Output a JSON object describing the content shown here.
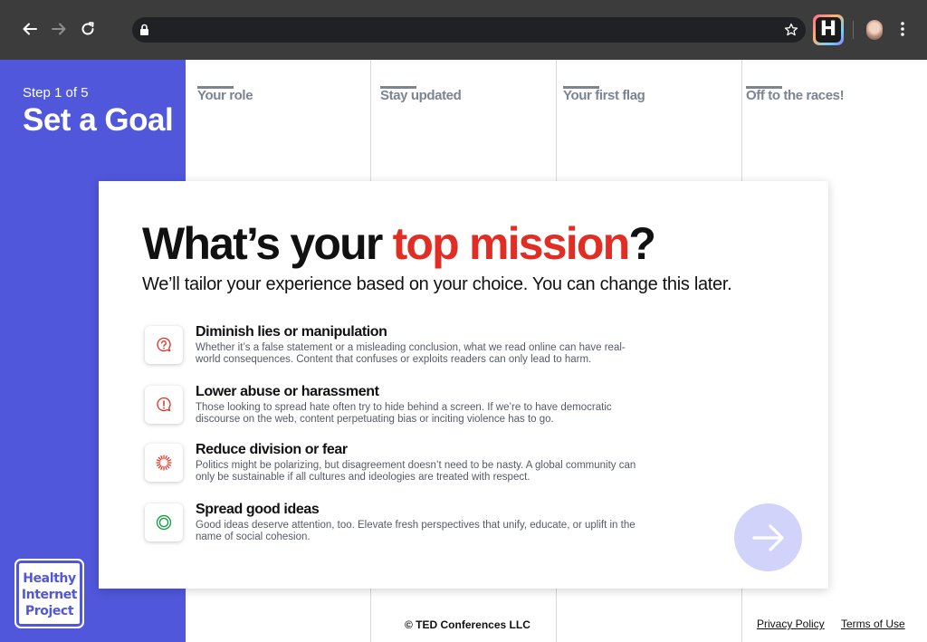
{
  "browser": {
    "url": "",
    "back_icon": "arrow-left-icon",
    "forward_icon": "arrow-right-icon",
    "reload_icon": "reload-icon",
    "lock_icon": "lock-icon",
    "bookmark_icon": "star-icon",
    "extension_icon": "H",
    "menu_icon": "kebab-menu-icon"
  },
  "sidebar": {
    "step_label": "Step 1 of 5",
    "step_title": "Set a Goal",
    "logo_lines": [
      "Healthy",
      "Internet",
      "Project"
    ],
    "color": "#5057db"
  },
  "steps": [
    {
      "label": "Your role"
    },
    {
      "label": "Stay updated"
    },
    {
      "label": "Your first flag"
    },
    {
      "label": "Off to the races!"
    }
  ],
  "card": {
    "heading_prefix": "What’s your ",
    "heading_accent": "top mission",
    "heading_suffix": "?",
    "accent_color": "#e12d23",
    "subheading": "We’ll tailor your experience based on your choice. You can change this later.",
    "options": [
      {
        "title": "Diminish lies or manipulation",
        "description": "Whether it’s a false statement or a misleading conclusion, what we read online can have real-world consequences. Content that confuses or exploits readers can only lead to harm.",
        "icon": "question-bubble-icon"
      },
      {
        "title": "Lower abuse or harassment",
        "description": "Those looking to spread hate often try to hide behind a screen. If we’re to have democratic discourse on the web, content perpetuating bias or inciting violence has to go.",
        "icon": "exclamation-bubble-icon"
      },
      {
        "title": "Reduce division or fear",
        "description": "Politics might be polarizing, but disagreement doesn’t need to be nasty. A global community can only be sustainable if all cultures and ideologies are treated with respect.",
        "icon": "burst-icon"
      },
      {
        "title": "Spread good ideas",
        "description": "Good ideas deserve attention, too. Elevate fresh perspectives that unify, educate, or uplift in the name of social cohesion.",
        "icon": "concentric-circles-icon"
      }
    ],
    "next_icon": "arrow-right-icon"
  },
  "footer": {
    "copyright": "© TED Conferences LLC",
    "privacy": "Privacy Policy",
    "terms": "Terms of Use"
  }
}
